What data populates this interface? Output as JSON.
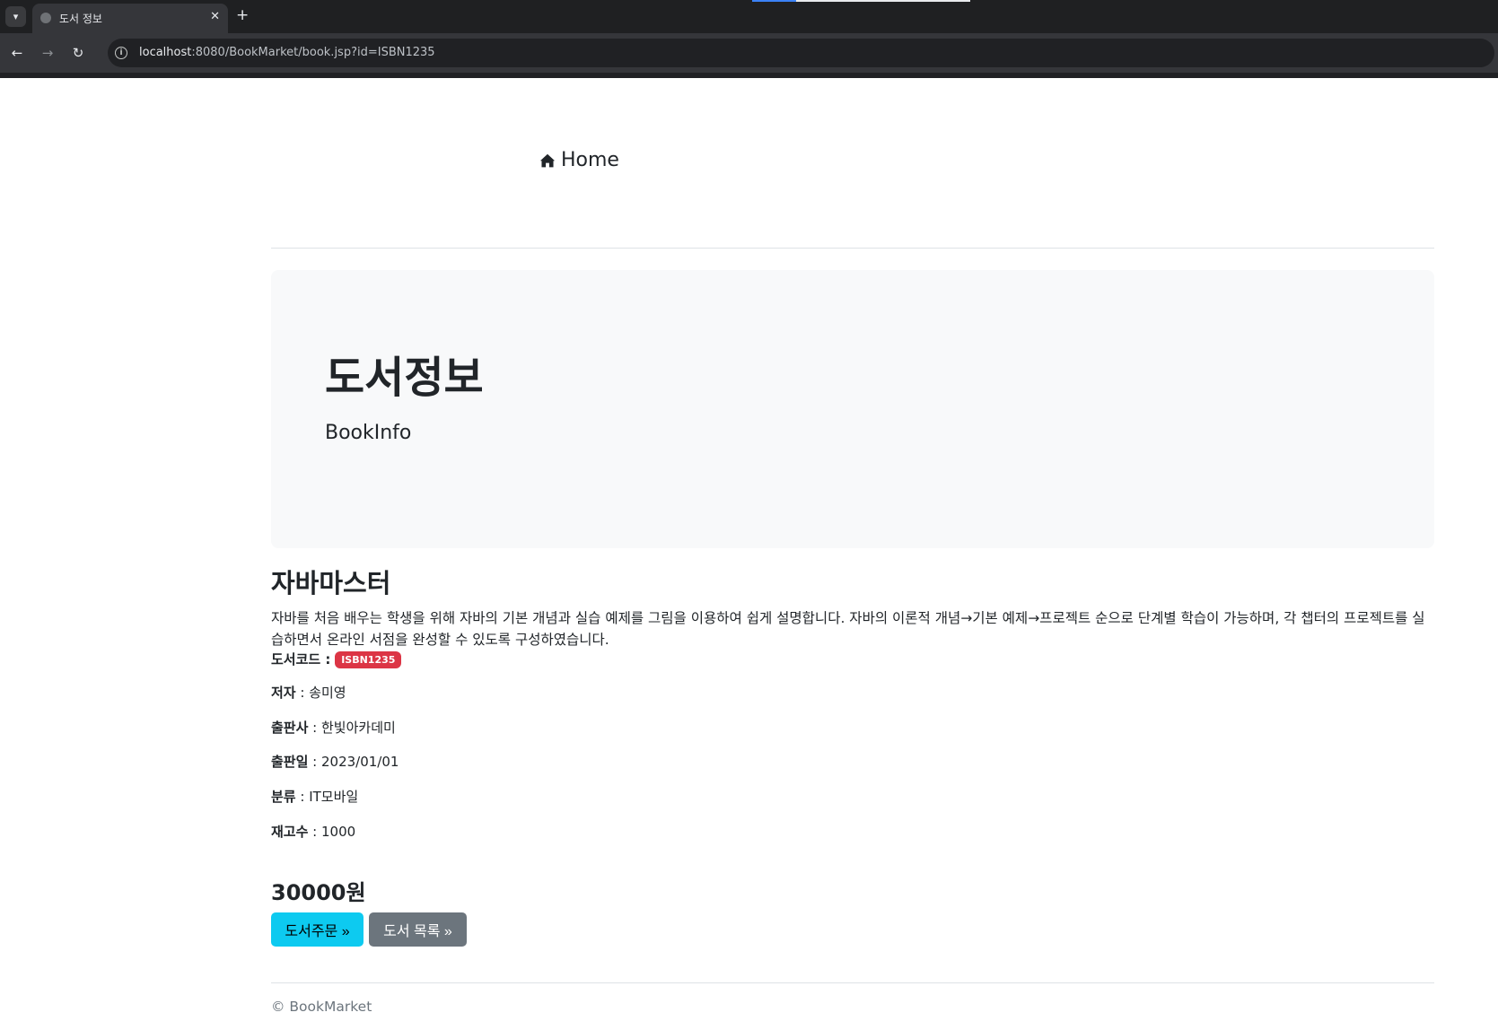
{
  "browser": {
    "tab_title": "도서 정보",
    "tab_close": "✕",
    "new_tab": "+",
    "url_host": "localhost",
    "url_rest": ":8080/BookMarket/book.jsp?id=ISBN1235",
    "icons": {
      "tab_search": "chevron-down-icon",
      "favicon": "globe-icon",
      "back": "arrow-left-icon",
      "forward": "arrow-right-icon",
      "reload": "reload-icon",
      "site_info": "info-icon"
    }
  },
  "nav": {
    "home_label": "Home",
    "home_icon": "home-icon"
  },
  "jumbotron": {
    "title": "도서정보",
    "subtitle": "BookInfo"
  },
  "book": {
    "name": "자바마스터",
    "description": "자바를 처음 배우는 학생을 위해 자바의 기본 개념과 실습 예제를 그림을 이용하여 쉽게 설명합니다. 자바의 이론적 개념→기본 예제→프로젝트 순으로 단계별 학습이 가능하며, 각 챕터의 프로젝트를 실습하면서 온라인 서점을 완성할 수 있도록 구성하였습니다.",
    "code_label": "도서코드 :",
    "code": "ISBN1235",
    "author_label": "저자",
    "author": " : 송미영",
    "publisher_label": "출판사",
    "publisher": " : 한빛아카데미",
    "release_label": "출판일",
    "release": " : 2023/01/01",
    "category_label": "분류",
    "category": " : IT모바일",
    "stock_label": "재고수",
    "stock": " : 1000",
    "price": "30000원"
  },
  "actions": {
    "order_label": "도서주문 »",
    "list_label": "도서 목록 »"
  },
  "footer": {
    "text": "© BookMarket"
  },
  "colors": {
    "badge": "#dc3545",
    "order_button": "#0dcaf0",
    "list_button": "#6c757d",
    "jumbotron_bg": "#f8f9fa"
  }
}
